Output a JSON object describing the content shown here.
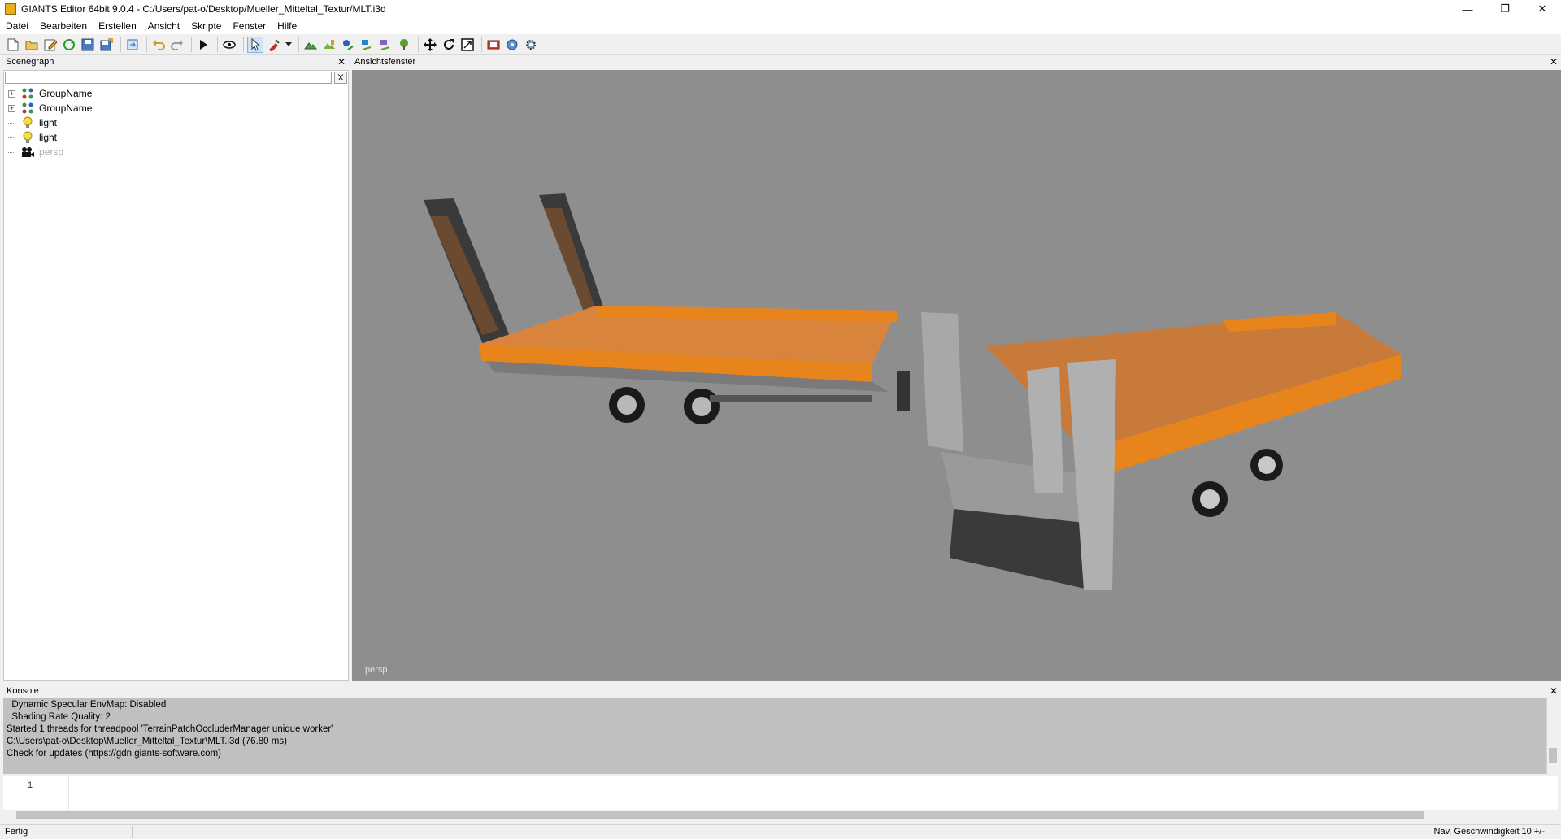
{
  "window": {
    "title": "GIANTS Editor 64bit 9.0.4 - C:/Users/pat-o/Desktop/Mueller_Mitteltal_Textur/MLT.i3d",
    "controls": [
      "minimize-icon",
      "restore-icon",
      "close-icon"
    ]
  },
  "menu": {
    "items": [
      "Datei",
      "Bearbeiten",
      "Erstellen",
      "Ansicht",
      "Skripte",
      "Fenster",
      "Hilfe"
    ]
  },
  "toolbar": {
    "icons": [
      "new-icon",
      "open-icon",
      "edit-icon",
      "reload-icon",
      "save-icon",
      "save-as-icon",
      "export-icon",
      "undo-icon",
      "redo-icon",
      "play-icon",
      "eye-icon",
      "select-icon",
      "paint-icon",
      "dropdown-icon",
      "terrain-icon",
      "terrain-paint-icon",
      "foliage-icon",
      "foliage-paint-icon",
      "decal-icon",
      "tree-icon",
      "move-icon",
      "rotate-icon",
      "scale-icon",
      "render-icon",
      "settings-icon",
      "gear-icon"
    ]
  },
  "scenegraph": {
    "title": "Scenegraph",
    "close": "✕",
    "search_value": "",
    "clear_label": "X",
    "items": [
      {
        "label": "GroupName",
        "icon": "group-icon",
        "expandable": true
      },
      {
        "label": "GroupName",
        "icon": "group-icon",
        "expandable": true
      },
      {
        "label": "light",
        "icon": "light-bulb-icon",
        "expandable": false
      },
      {
        "label": "light",
        "icon": "light-bulb-icon",
        "expandable": false
      },
      {
        "label": "persp",
        "icon": "camera-icon",
        "expandable": false,
        "dim": true
      }
    ]
  },
  "viewport": {
    "title": "Ansichtsfenster",
    "close": "✕",
    "camera_label": "persp",
    "background": "#8e8e8e",
    "accent_orange": "#e8841c"
  },
  "console": {
    "title": "Konsole",
    "close": "✕",
    "lines": [
      "  Dynamic Specular EnvMap: Disabled",
      "  Shading Rate Quality: 2",
      "Started 1 threads for threadpool 'TerrainPatchOccluderManager unique worker'",
      "C:\\Users\\pat-o\\Desktop\\Mueller_Mitteltal_Textur\\MLT.i3d (76.80 ms)",
      "Check for updates (https://gdn.giants-software.com)"
    ],
    "editor_line_number": "1"
  },
  "status": {
    "left": "Fertig",
    "right": "Nav. Geschwindigkeit 10 +/-"
  }
}
